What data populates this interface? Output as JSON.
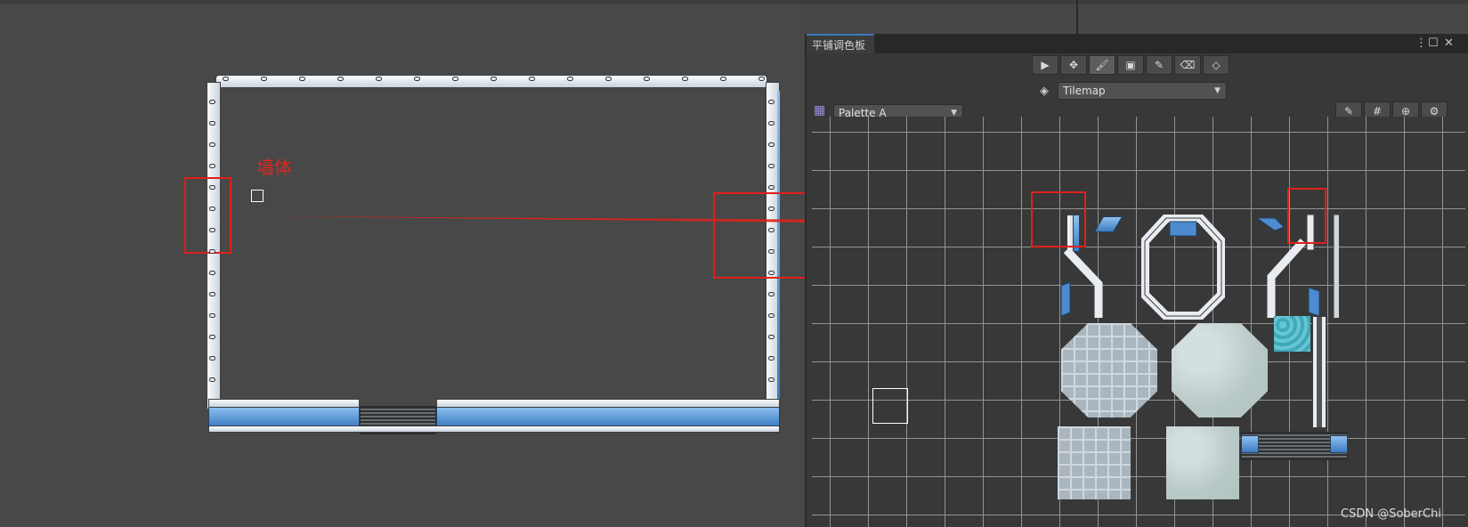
{
  "scene": {
    "annotation_label": "墙体"
  },
  "palette_window": {
    "title": "平铺调色板",
    "tools": [
      {
        "name": "select",
        "glyph": "▶"
      },
      {
        "name": "move",
        "glyph": "✥"
      },
      {
        "name": "paint",
        "glyph": "🖌"
      },
      {
        "name": "box-fill",
        "glyph": "▣"
      },
      {
        "name": "picker",
        "glyph": "✎"
      },
      {
        "name": "erase",
        "glyph": "⌫"
      },
      {
        "name": "fill",
        "glyph": "◇"
      }
    ],
    "active_tool": "paint",
    "target_tilemap": "Tilemap",
    "palette": "Palette A",
    "right_buttons": [
      {
        "name": "edit",
        "glyph": "✎"
      },
      {
        "name": "grid",
        "glyph": "#"
      },
      {
        "name": "gizmos",
        "glyph": "⊕"
      },
      {
        "name": "tile-settings",
        "glyph": "⚙"
      }
    ]
  },
  "watermark": "CSDN @SoberChi",
  "colors": {
    "annotation": "#e0201a",
    "accent_tab": "#3a79bb"
  }
}
